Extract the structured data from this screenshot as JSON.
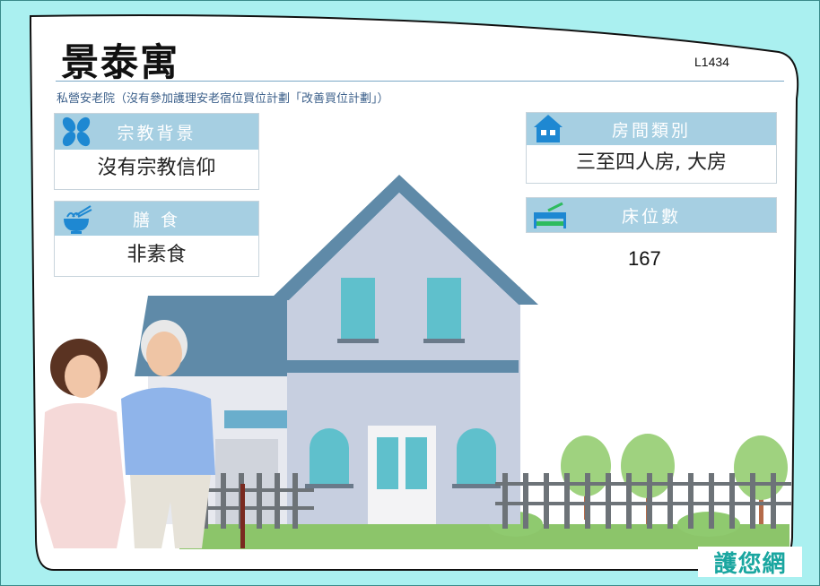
{
  "header": {
    "title": "景泰寓",
    "code": "L1434",
    "subtitle": "私營安老院（沒有參加護理安老宿位買位計劃「改善買位計劃」）"
  },
  "info": {
    "religion": {
      "label": "宗教背景",
      "value": "沒有宗教信仰",
      "icon": "leaf-icon"
    },
    "meal": {
      "label": "膳 食",
      "value": "非素食",
      "icon": "noodle-bowl-icon"
    },
    "room": {
      "label": "房間類別",
      "value": "三至四人房, 大房",
      "icon": "house-icon"
    },
    "beds": {
      "label": "床位數",
      "value": "167",
      "icon": "bed-icon"
    }
  },
  "brand": {
    "logo_text": "護您網"
  },
  "colors": {
    "background": "#aaf0f0",
    "header_bar": "#a6cfe2",
    "brand_green": "#1aa6a0"
  }
}
